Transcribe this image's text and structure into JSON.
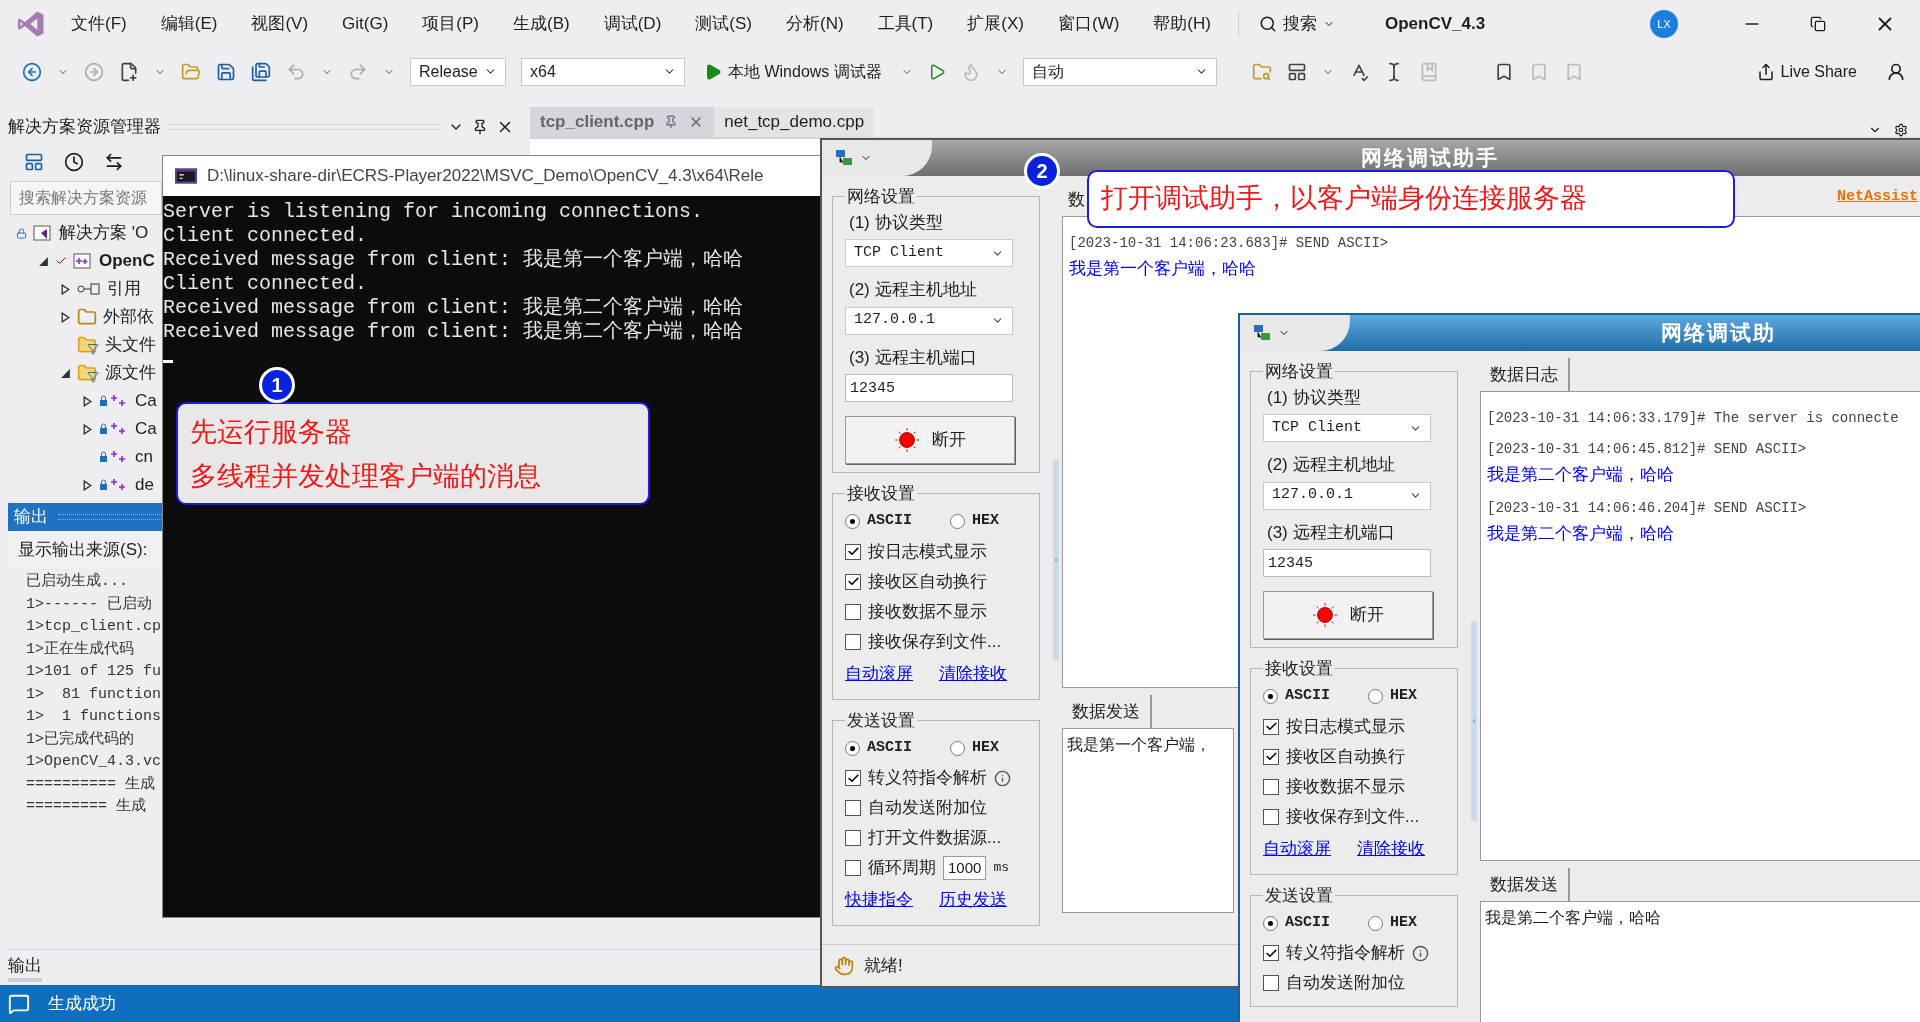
{
  "menu_bar": {
    "items": [
      "文件(F)",
      "编辑(E)",
      "视图(V)",
      "Git(G)",
      "项目(P)",
      "生成(B)",
      "调试(D)",
      "测试(S)",
      "分析(N)",
      "工具(T)",
      "扩展(X)",
      "窗口(W)",
      "帮助(H)"
    ],
    "search": "搜索",
    "project": "OpenCV_4.3",
    "avatar": "LX"
  },
  "toolbar": {
    "configuration": "Release",
    "platform": "x64",
    "debugger": "本地 Windows 调试器",
    "target": "自动",
    "live_share": "Live Share"
  },
  "solution_explorer": {
    "title": "解决方案资源管理器",
    "search_placeholder": "搜索解决方案资源",
    "tree": [
      {
        "kind": "solution",
        "label": "解决方案 'O",
        "children": [
          {
            "kind": "project",
            "label": "OpenC",
            "expanded": true,
            "children": [
              {
                "kind": "references",
                "label": "引用",
                "expanded": false
              },
              {
                "kind": "external",
                "label": "外部依",
                "expanded": false
              },
              {
                "kind": "filter",
                "label": "头文件"
              },
              {
                "kind": "filter",
                "label": "源文件",
                "expanded": true,
                "children": [
                  {
                    "kind": "source",
                    "label": "Ca",
                    "expanded": false
                  },
                  {
                    "kind": "source",
                    "label": "Ca",
                    "expanded": false
                  },
                  {
                    "kind": "source",
                    "label": "cn"
                  },
                  {
                    "kind": "source",
                    "label": "de",
                    "expanded": false
                  }
                ]
              }
            ]
          }
        ]
      }
    ]
  },
  "editor_tabs": [
    {
      "label": "tcp_client.cpp",
      "selected": true
    },
    {
      "label": "net_tcp_demo.cpp",
      "selected": false
    }
  ],
  "output": {
    "title": "输出",
    "source_label": "显示输出来源(S):",
    "lines": [
      "已启动生成...",
      "1>------ 已启动",
      "1>tcp_client.cp",
      "1>正在生成代码",
      "1>101 of 125 fu",
      "1>  81 function",
      "1>  1 functions",
      "1>已完成代码的",
      "1>OpenCV_4.3.vc",
      "========== 生成",
      "========= 生成"
    ],
    "bottom_tab": "输出"
  },
  "status_bar": {
    "text": "生成成功"
  },
  "console": {
    "title": "D:\\linux-share-dir\\ECRS-Player2022\\MSVC_Demo\\OpenCV_4.3\\x64\\Rele",
    "lines": [
      "Server is listening for incoming connections.",
      "Client connected.",
      "Received message from client: 我是第一个客户端，哈哈",
      "Client connected.",
      "Received message from client: 我是第二个客户端，哈哈",
      "Received message from client: 我是第二个客户端，哈哈"
    ]
  },
  "net_assist_windows": [
    {
      "title": "网络调试助手",
      "active": false,
      "network_settings": {
        "title": "网络设置",
        "protocol_label": "(1) 协议类型",
        "protocol": "TCP Client",
        "host_label": "(2) 远程主机地址",
        "host": "127.0.0.1",
        "port_label": "(3) 远程主机端口",
        "port": "12345",
        "connect_button": "断开"
      },
      "receive_settings": {
        "title": "接收设置",
        "encodings": [
          {
            "label": "ASCII",
            "selected": true
          },
          {
            "label": "HEX",
            "selected": false
          }
        ],
        "options": [
          {
            "label": "按日志模式显示",
            "checked": true
          },
          {
            "label": "接收区自动换行",
            "checked": true
          },
          {
            "label": "接收数据不显示",
            "checked": false
          },
          {
            "label": "接收保存到文件...",
            "checked": false
          }
        ],
        "links": [
          "自动滚屏",
          "清除接收"
        ]
      },
      "send_settings": {
        "title": "发送设置",
        "encodings": [
          {
            "label": "ASCII",
            "selected": true
          },
          {
            "label": "HEX",
            "selected": false
          }
        ],
        "options": [
          {
            "label": "转义符指令解析",
            "checked": true,
            "info": true
          },
          {
            "label": "自动发送附加位",
            "checked": false
          },
          {
            "label": "打开文件数据源...",
            "checked": false
          },
          {
            "label": "循环周期",
            "checked": false,
            "period": "1000",
            "unit": "ms"
          }
        ],
        "links": [
          "快捷指令",
          "历史发送"
        ]
      },
      "log_tab": "数",
      "brand": "NetAssist",
      "log": [
        {
          "header": "[2023-10-31 14:06:23.683]# SEND ASCII>",
          "message": "我是第一个客户端，哈哈"
        }
      ],
      "send_tab": "数据发送",
      "send_text": "我是第一个客户端，",
      "status": "就绪!"
    },
    {
      "title": "网络调试助",
      "active": true,
      "network_settings": {
        "title": "网络设置",
        "protocol_label": "(1) 协议类型",
        "protocol": "TCP Client",
        "host_label": "(2) 远程主机地址",
        "host": "127.0.0.1",
        "port_label": "(3) 远程主机端口",
        "port": "12345",
        "connect_button": "断开"
      },
      "receive_settings": {
        "title": "接收设置",
        "encodings": [
          {
            "label": "ASCII",
            "selected": true
          },
          {
            "label": "HEX",
            "selected": false
          }
        ],
        "options": [
          {
            "label": "按日志模式显示",
            "checked": true
          },
          {
            "label": "接收区自动换行",
            "checked": true
          },
          {
            "label": "接收数据不显示",
            "checked": false
          },
          {
            "label": "接收保存到文件...",
            "checked": false
          }
        ],
        "links": [
          "自动滚屏",
          "清除接收"
        ]
      },
      "send_settings": {
        "title": "发送设置",
        "encodings": [
          {
            "label": "ASCII",
            "selected": true
          },
          {
            "label": "HEX",
            "selected": false
          }
        ],
        "options": [
          {
            "label": "转义符指令解析",
            "checked": true,
            "info": true
          },
          {
            "label": "自动发送附加位",
            "checked": false
          }
        ]
      },
      "log_tab": "数据日志",
      "log": [
        {
          "header": "[2023-10-31 14:06:33.179]# The server is connecte"
        },
        {
          "header": "[2023-10-31 14:06:45.812]# SEND ASCII>",
          "message": "我是第二个客户端，哈哈"
        },
        {
          "header": "[2023-10-31 14:06:46.204]# SEND ASCII>",
          "message": "我是第二个客户端，哈哈"
        }
      ],
      "send_tab": "数据发送",
      "send_text": "我是第二个客户端，哈哈"
    }
  ],
  "callouts": [
    {
      "number": "1",
      "lines": [
        "先运行服务器",
        "多线程并发处理客户端的消息"
      ]
    },
    {
      "number": "2",
      "lines": [
        "打开调试助手，以客户端身份连接服务器"
      ]
    }
  ]
}
